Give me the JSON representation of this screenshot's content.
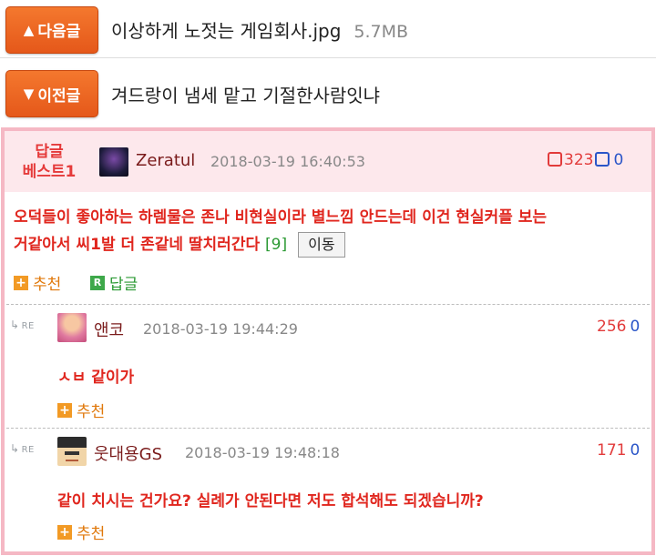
{
  "nav": {
    "next": {
      "label": "다음글",
      "title": "이상하게 노젓는 게임회사.jpg",
      "size": "5.7MB"
    },
    "prev": {
      "label": "이전글",
      "title": "겨드랑이 냄세 맡고 기절한사람잇냐"
    }
  },
  "best": {
    "label_line1": "답글",
    "label_line2": "베스트1",
    "nick": "Zeratul",
    "date": "2018-03-19 16:40:53",
    "upvotes": "323",
    "downvotes": "0",
    "text_line1": "오덕들이 좋아하는 하렘물은 존나 비현실이라 별느낌 안드는데 이건 현실커플 보는",
    "text_line2": "거같아서 씨1발 더 존같네 딸치러간다",
    "reply_count": "[9]",
    "move_label": "이동",
    "recommend_label": "추천",
    "reply_label": "답글"
  },
  "replies": [
    {
      "re": "RE",
      "nick": "앤코",
      "date": "2018-03-19 19:44:29",
      "upvotes": "256",
      "downvotes": "0",
      "text": "ㅅㅂ 같이가",
      "recommend_label": "추천"
    },
    {
      "re": "RE",
      "nick": "웃대용GS",
      "date": "2018-03-19 19:48:18",
      "upvotes": "171",
      "downvotes": "0",
      "text": "같이 치시는 건가요? 실례가 안된다면 저도 합석해도 되겠습니까?",
      "recommend_label": "추천"
    }
  ],
  "colors": {
    "accent": "#e5581a",
    "best_bg": "#fde8ec",
    "border": "#f5b8c4",
    "text_red": "#e0261e"
  }
}
